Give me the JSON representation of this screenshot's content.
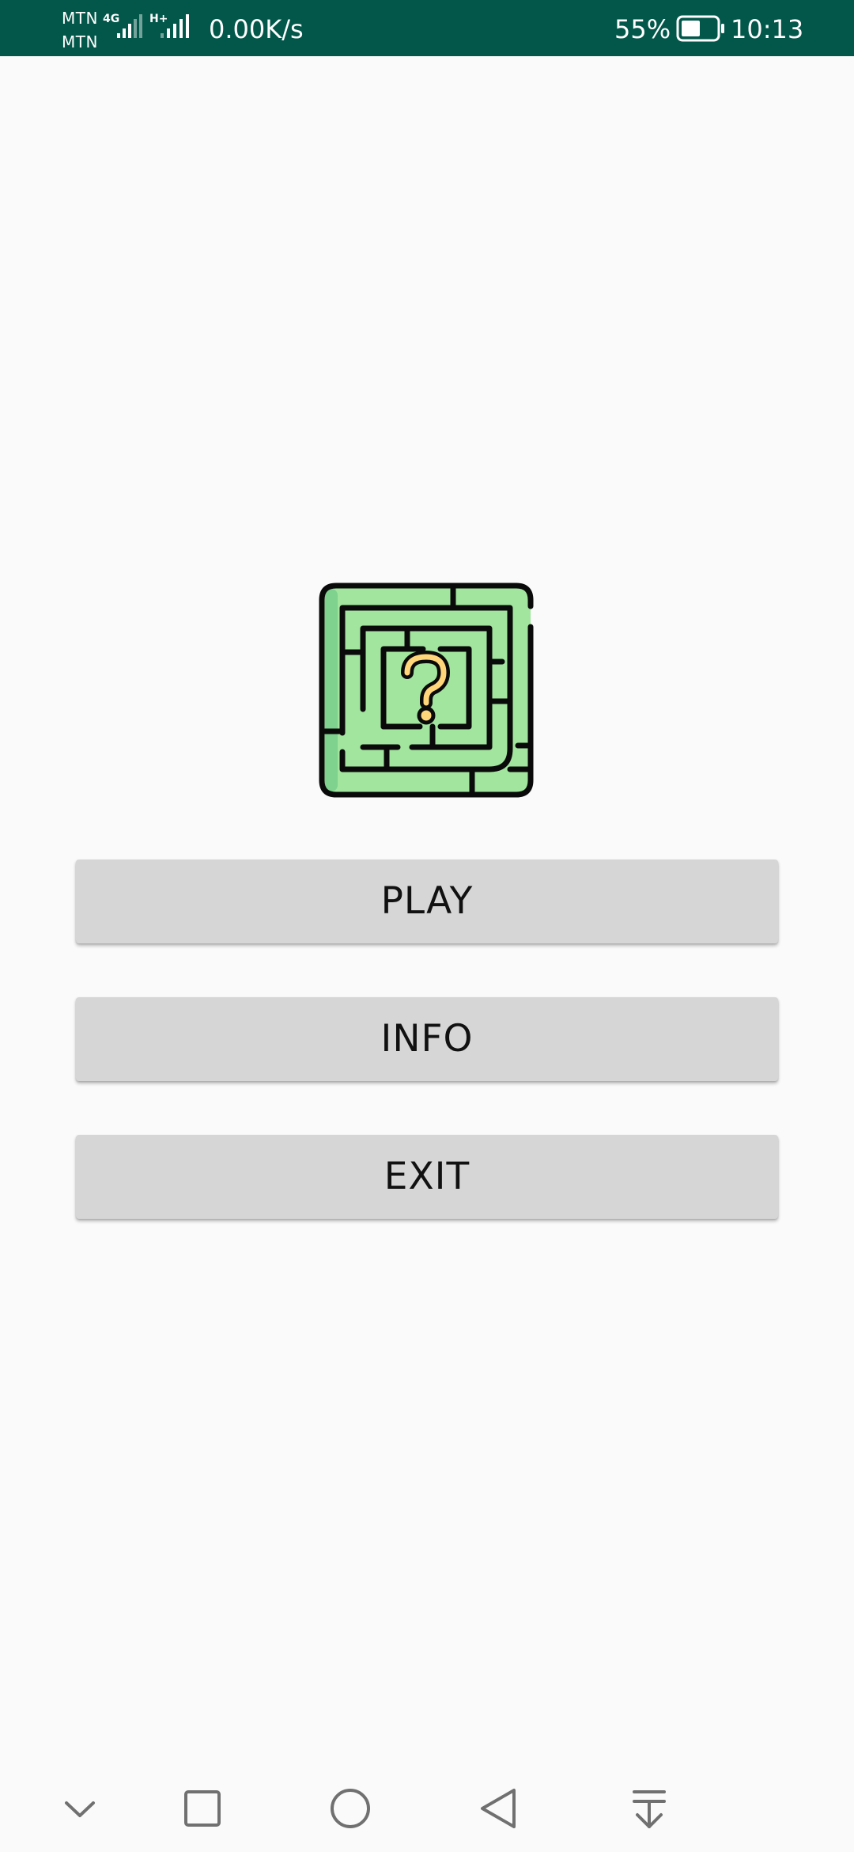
{
  "status_bar": {
    "carrier_1": "MTN",
    "carrier_2": "MTN",
    "network_1": "4G",
    "network_2": "H+",
    "net_speed": "0.00K/s",
    "battery_percent": "55%",
    "battery_level": 0.55,
    "time": "10:13"
  },
  "main": {
    "logo_icon": "maze-question-icon",
    "buttons": [
      {
        "label": "PLAY"
      },
      {
        "label": "INFO"
      },
      {
        "label": "EXIT"
      }
    ]
  },
  "nav_bar": {
    "icons": [
      "chevron-down-icon",
      "recents-square-icon",
      "home-circle-icon",
      "back-triangle-icon",
      "notification-pull-icon"
    ]
  },
  "colors": {
    "status_bar_bg": "#02574a",
    "background": "#fafafa",
    "button_bg": "#d6d6d6",
    "maze_green": "#a2e59e",
    "maze_shade": "#7fd18e",
    "question_yellow": "#ffd77a"
  }
}
